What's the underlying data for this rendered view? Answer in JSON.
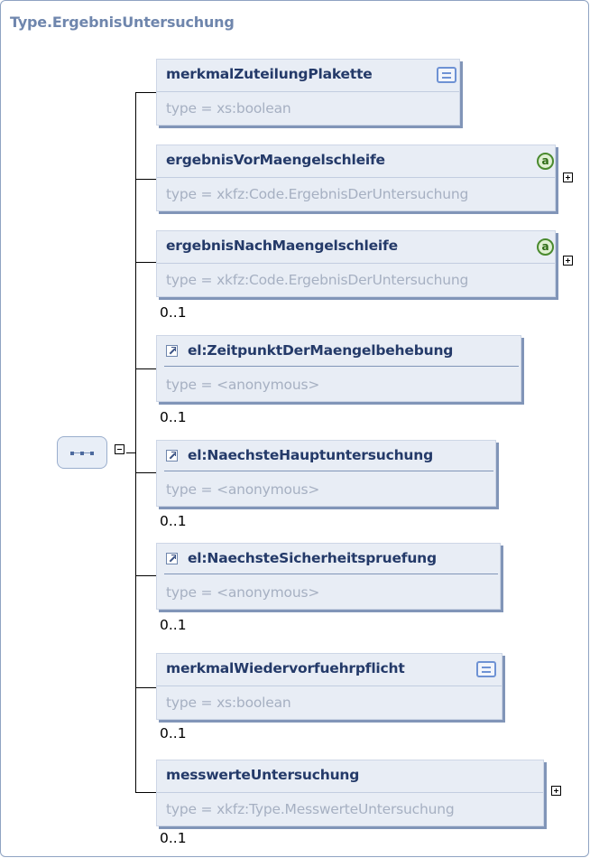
{
  "diagram": {
    "title": "Type.ErgebnisUntersuchung",
    "compositor": {
      "kind": "sequence",
      "icon": "sequence-icon"
    },
    "elements": [
      {
        "name": "merkmalZuteilungPlakette",
        "type": "type = xs:boolean",
        "cardinality": "",
        "icon": "documentation-icon",
        "expandable": false
      },
      {
        "name": "ergebnisVorMaengelschleife",
        "type": "type = xkfz:Code.ErgebnisDerUntersuchung",
        "cardinality": "",
        "icon": "attribute-icon",
        "icon_label": "a",
        "expandable": true
      },
      {
        "name": "ergebnisNachMaengelschleife",
        "type": "type = xkfz:Code.ErgebnisDerUntersuchung",
        "cardinality": "0..1",
        "icon": "attribute-icon",
        "icon_label": "a",
        "expandable": true
      },
      {
        "name": "el:ZeitpunktDerMaengelbehebung",
        "type": "type = <anonymous>",
        "cardinality": "0..1",
        "icon": "reference-icon",
        "expandable": false
      },
      {
        "name": "el:NaechsteHauptuntersuchung",
        "type": "type = <anonymous>",
        "cardinality": "0..1",
        "icon": "reference-icon",
        "expandable": false
      },
      {
        "name": "el:NaechsteSicherheitspruefung",
        "type": "type = <anonymous>",
        "cardinality": "0..1",
        "icon": "reference-icon",
        "expandable": false
      },
      {
        "name": "merkmalWiedervorfuehrpflicht",
        "type": "type = xs:boolean",
        "cardinality": "0..1",
        "icon": "documentation-icon",
        "expandable": false
      },
      {
        "name": "messwerteUntersuchung",
        "type": "type = xkfz:Type.MesswerteUntersuchung",
        "cardinality": "0..1",
        "icon": "",
        "expandable": true
      }
    ]
  },
  "colors": {
    "title": "#6f86ad",
    "element_name": "#243a69",
    "type_text": "#a6b0c2",
    "element_fill": "#e8edf5",
    "element_shadow": "#8195b8",
    "attribute_icon": "#4a8a2e"
  }
}
